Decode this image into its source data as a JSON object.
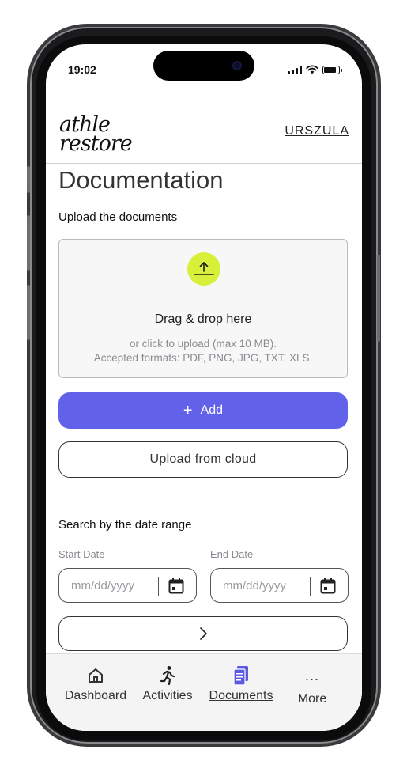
{
  "status_bar": {
    "time": "19:02"
  },
  "header": {
    "logo_line1": "athle",
    "logo_line2": "restore",
    "user_name": "URSZULA"
  },
  "page": {
    "title": "Documentation",
    "upload_label": "Upload the documents"
  },
  "dropzone": {
    "icon": "upload-icon",
    "title": "Drag & drop here",
    "hint_line1": "or click to upload (max 10 MB).",
    "hint_line2": "Accepted formats: PDF, PNG, JPG, TXT, XLS."
  },
  "buttons": {
    "add_icon": "+",
    "add_label": "Add",
    "cloud_label": "Upload from cloud",
    "go_icon": "chevron-right-icon"
  },
  "search": {
    "label": "Search by the date range",
    "start_label": "Start Date",
    "end_label": "End Date",
    "start_placeholder": "mm/dd/yyyy",
    "end_placeholder": "mm/dd/yyyy"
  },
  "tabbar": {
    "items": [
      {
        "label": "Dashboard",
        "icon": "home-icon"
      },
      {
        "label": "Activities",
        "icon": "running-icon"
      },
      {
        "label": "Documents",
        "icon": "document-icon",
        "active": true
      },
      {
        "label": "More",
        "icon": "ellipsis-icon",
        "glyph": "..."
      }
    ]
  },
  "colors": {
    "accent": "#6261ea",
    "upload_highlight": "#d9f03a",
    "active_tab_icon": "#5b5be0"
  }
}
